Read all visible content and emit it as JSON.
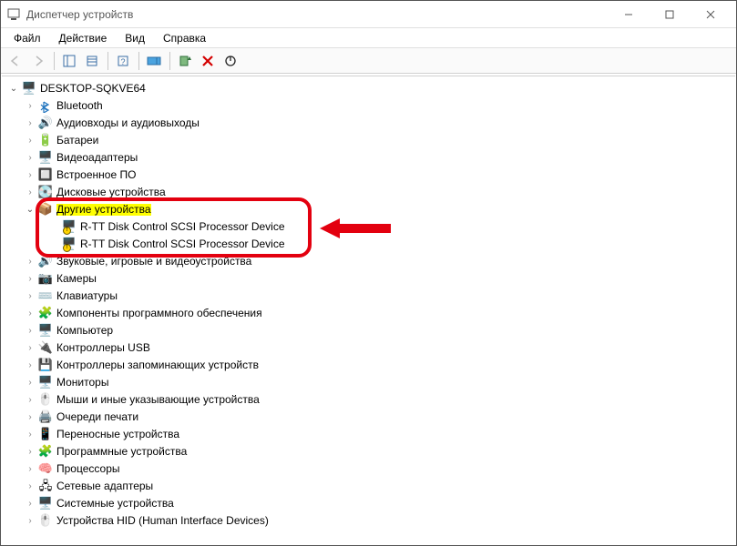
{
  "window": {
    "title": "Диспетчер устройств"
  },
  "menu": {
    "file": "Файл",
    "action": "Действие",
    "view": "Вид",
    "help": "Справка"
  },
  "tree": {
    "root": "DESKTOP-SQKVE64",
    "bluetooth": "Bluetooth",
    "audio_io": "Аудиовходы и аудиовыходы",
    "batteries": "Батареи",
    "display_adapters": "Видеоадаптеры",
    "firmware": "Встроенное ПО",
    "disk_drives": "Дисковые устройства",
    "other_devices": "Другие устройства",
    "rtt1": "R-TT Disk Control SCSI Processor Device",
    "rtt2": "R-TT Disk Control SCSI Processor Device",
    "sound_video_game": "Звуковые, игровые и видеоустройства",
    "cameras": "Камеры",
    "keyboards": "Клавиатуры",
    "software_components": "Компоненты программного обеспечения",
    "computer": "Компьютер",
    "usb_controllers": "Контроллеры USB",
    "storage_controllers": "Контроллеры запоминающих устройств",
    "monitors": "Мониторы",
    "mice": "Мыши и иные указывающие устройства",
    "print_queues": "Очереди печати",
    "portable": "Переносные устройства",
    "software_devices": "Программные устройства",
    "processors": "Процессоры",
    "net_adapters": "Сетевые адаптеры",
    "system_devices": "Системные устройства",
    "hid": "Устройства HID (Human Interface Devices)"
  }
}
